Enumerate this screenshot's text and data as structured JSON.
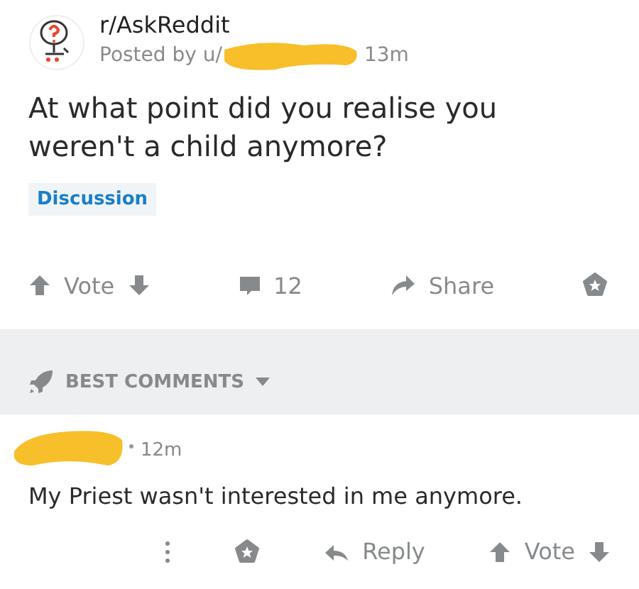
{
  "post": {
    "subreddit": "r/AskReddit",
    "posted_by": "Posted by u/",
    "age": "13m",
    "title": "At what point did you realise you weren't a child anymore?",
    "flair": "Discussion"
  },
  "post_actions": {
    "vote": "Vote",
    "comments": "12",
    "share": "Share"
  },
  "sort": {
    "label": "BEST COMMENTS"
  },
  "comment": {
    "age": "12m",
    "text": "My Priest wasn't interested in me anymore.",
    "reply": "Reply",
    "vote": "Vote"
  }
}
